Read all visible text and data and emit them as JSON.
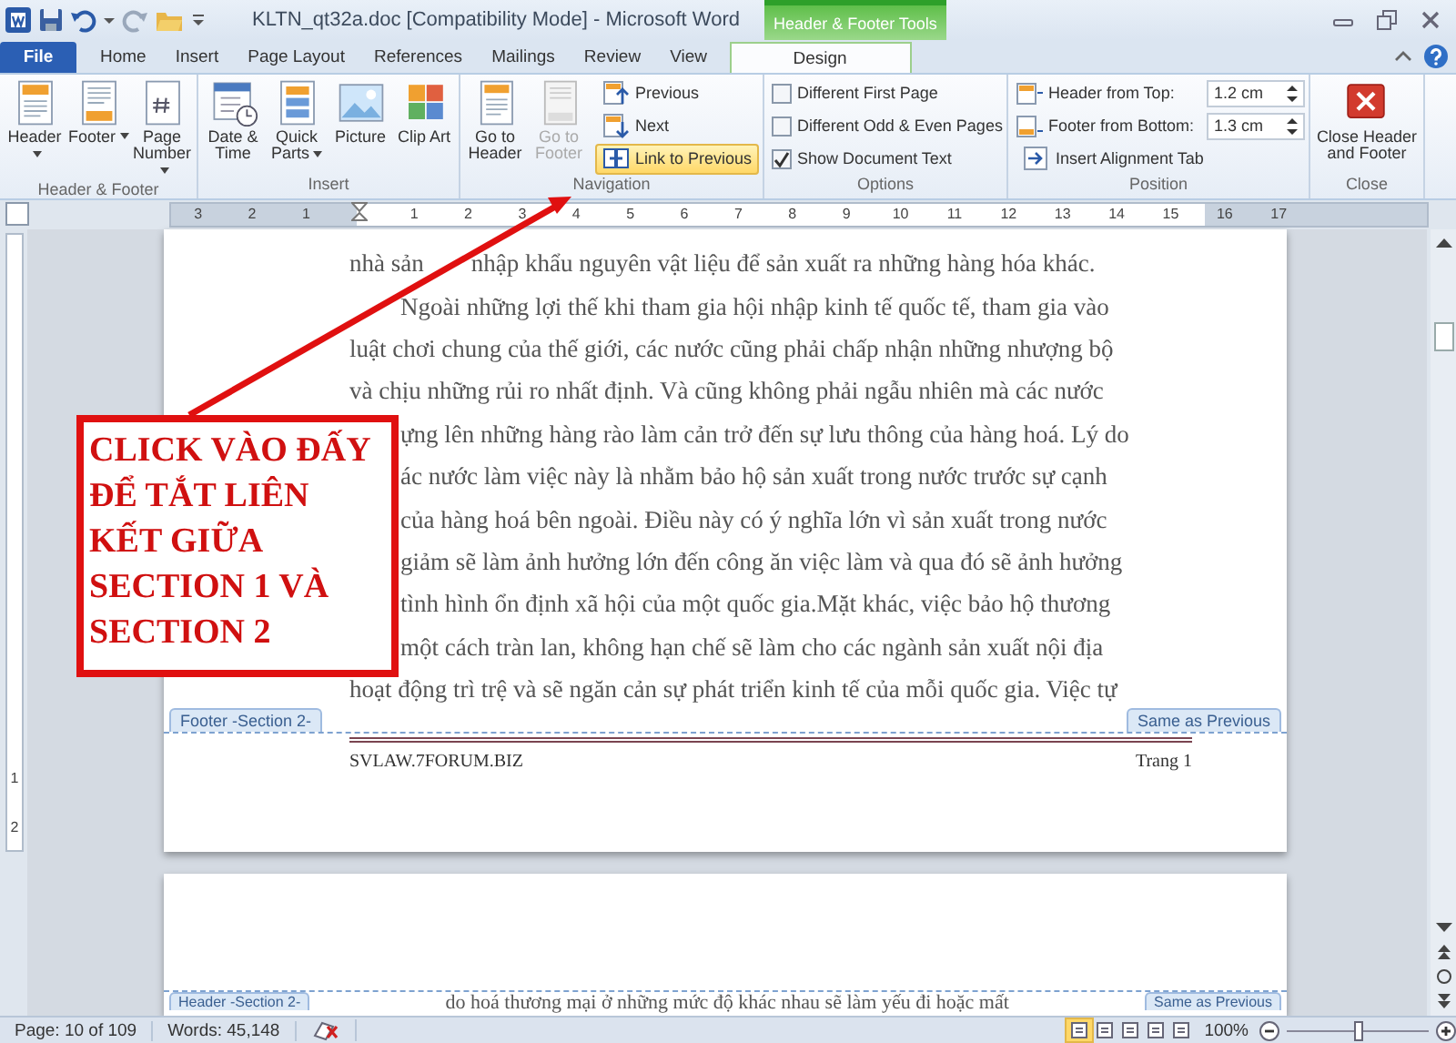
{
  "title_bar": {
    "title": "KLTN_qt32a.doc [Compatibility Mode]  -  Microsoft Word",
    "context_tab_group": "Header & Footer Tools"
  },
  "tabs": [
    {
      "label": "File",
      "kind": "file",
      "selected": false
    },
    {
      "label": "Home",
      "kind": "normal",
      "selected": false
    },
    {
      "label": "Insert",
      "kind": "normal",
      "selected": false
    },
    {
      "label": "Page Layout",
      "kind": "normal",
      "selected": false
    },
    {
      "label": "References",
      "kind": "normal",
      "selected": false
    },
    {
      "label": "Mailings",
      "kind": "normal",
      "selected": false
    },
    {
      "label": "Review",
      "kind": "normal",
      "selected": false
    },
    {
      "label": "View",
      "kind": "normal",
      "selected": false
    },
    {
      "label": "Design",
      "kind": "context",
      "selected": true
    }
  ],
  "ribbon": {
    "groups": [
      {
        "label": "Header & Footer",
        "items": [
          {
            "kind": "large",
            "label": "Header",
            "dropdown": true,
            "disabled": false
          },
          {
            "kind": "large",
            "label": "Footer",
            "dropdown": true,
            "disabled": false
          },
          {
            "kind": "large",
            "label": "Page Number",
            "dropdown": true,
            "disabled": false
          }
        ]
      },
      {
        "label": "Insert",
        "items": [
          {
            "kind": "large",
            "label": "Date & Time",
            "dropdown": false,
            "disabled": false
          },
          {
            "kind": "large",
            "label": "Quick Parts",
            "dropdown": true,
            "disabled": false
          },
          {
            "kind": "large",
            "label": "Picture",
            "dropdown": false,
            "disabled": false
          },
          {
            "kind": "large",
            "label": "Clip Art",
            "dropdown": false,
            "disabled": false
          }
        ]
      },
      {
        "label": "Navigation",
        "items": [
          {
            "kind": "large",
            "label": "Go to Header",
            "dropdown": false,
            "disabled": false
          },
          {
            "kind": "large",
            "label": "Go to Footer",
            "dropdown": false,
            "disabled": true
          },
          {
            "kind": "small",
            "label": "Previous",
            "selected": false
          },
          {
            "kind": "small",
            "label": "Next",
            "selected": false
          },
          {
            "kind": "small",
            "label": "Link to Previous",
            "selected": true
          }
        ]
      },
      {
        "label": "Options",
        "items": [
          {
            "kind": "check",
            "label": "Different First Page",
            "checked": false
          },
          {
            "kind": "check",
            "label": "Different Odd & Even Pages",
            "checked": false
          },
          {
            "kind": "check",
            "label": "Show Document Text",
            "checked": true
          }
        ]
      },
      {
        "label": "Position",
        "items": [
          {
            "kind": "spin",
            "label": "Header from Top:",
            "value": "1.2 cm"
          },
          {
            "kind": "spin",
            "label": "Footer from Bottom:",
            "value": "1.3 cm"
          },
          {
            "kind": "small",
            "label": "Insert Alignment Tab",
            "selected": false
          }
        ]
      },
      {
        "label": "Close",
        "items": [
          {
            "kind": "large",
            "label": "Close Header and Footer",
            "dropdown": false,
            "disabled": false
          }
        ]
      }
    ]
  },
  "ruler": {
    "left_labels": [
      "3",
      "2",
      "1"
    ],
    "right_labels": [
      "1",
      "2",
      "3",
      "4",
      "5",
      "6",
      "7",
      "8",
      "9",
      "10",
      "11",
      "12",
      "13",
      "14",
      "15",
      "16",
      "17"
    ]
  },
  "vertical_ruler": {
    "labels": [
      "1",
      "2"
    ]
  },
  "page_1": {
    "lines": [
      {
        "kind": "split",
        "text": "nhà sản",
        "after": "nhập khẩu nguyên vật liệu  để sản xuất ra những hàng hóa khác."
      },
      {
        "kind": "indent",
        "text": "Ngoài những lợi thế khi tham gia hội nhập kinh tế quốc tế, tham gia vào"
      },
      {
        "kind": "line",
        "text": "luật chơi chung của thế giới, các nước cũng phải chấp nhận những nhượng bộ"
      },
      {
        "kind": "line",
        "text": "và chịu những rủi ro nhất định. Và cũng không phải ngẫu nhiên mà các nước"
      },
      {
        "kind": "partial",
        "text": "ựng lên những hàng rào làm cản trở đến sự lưu thông của hàng hoá. Lý do"
      },
      {
        "kind": "partial",
        "text": "ác nước làm việc này là nhằm bảo hộ sản xuất trong nước trước sự cạnh"
      },
      {
        "kind": "partial",
        "text": "của hàng hoá bên ngoài. Điều này có ý nghĩa lớn vì sản xuất trong nước"
      },
      {
        "kind": "partial",
        "text": "giảm sẽ làm ảnh hưởng lớn đến công ăn việc làm và qua đó sẽ ảnh hưởng"
      },
      {
        "kind": "partial",
        "text": "tình hình ổn định xã hội của một quốc gia.Mặt khác, việc bảo hộ thương"
      },
      {
        "kind": "partial",
        "text": "một cách tràn lan, không hạn chế sẽ làm cho các ngành sản xuất nội địa"
      },
      {
        "kind": "line",
        "text": "hoạt động trì trệ và sẽ ngăn cản sự phát triển kinh tế của mỗi quốc gia. Việc tự"
      }
    ],
    "footer_tag": "Footer -Section 2-",
    "same_as_previous": "Same as Previous",
    "footer_left": "SVLAW.7FORUM.BIZ",
    "footer_right": "Trang 1"
  },
  "page_2": {
    "header_tag": "Header -Section 2-",
    "same_as_previous": "Same as Previous",
    "line": "do hoá thương mại ở những mức độ khác nhau sẽ làm yếu  đi hoặc mất"
  },
  "callout": {
    "text": "CLICK VÀO ĐẤY ĐỂ TẮT LIÊN KẾT GIỮA SECTION 1 VÀ SECTION 2"
  },
  "status_bar": {
    "page": "Page: 10 of 109",
    "words": "Words: 45,148",
    "views": [
      {
        "selected": true
      },
      {
        "selected": false
      },
      {
        "selected": false
      },
      {
        "selected": false
      },
      {
        "selected": false
      }
    ],
    "zoom": {
      "reading": "100%",
      "level": 0.5
    }
  }
}
